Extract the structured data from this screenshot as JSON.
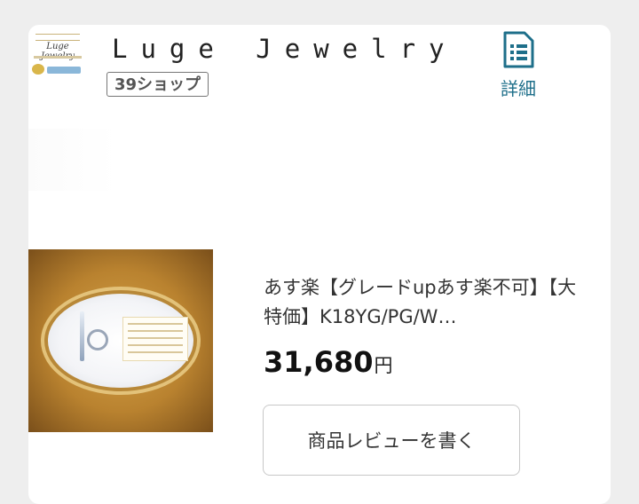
{
  "shop": {
    "logo_text": "Luge Jewelry",
    "name": "Luge Jewelry",
    "badge": "39ショップ",
    "detail_label": "詳細",
    "detail_icon": "document-list-icon"
  },
  "product": {
    "title": "あす楽【グレードupあす楽不可】【大特価】K18YG/PG/W…",
    "price": "31,680",
    "currency": "円",
    "review_button": "商品レビューを書く"
  },
  "colors": {
    "accent": "#1e6f8a",
    "background": "#eeeeee",
    "card": "#ffffff"
  }
}
